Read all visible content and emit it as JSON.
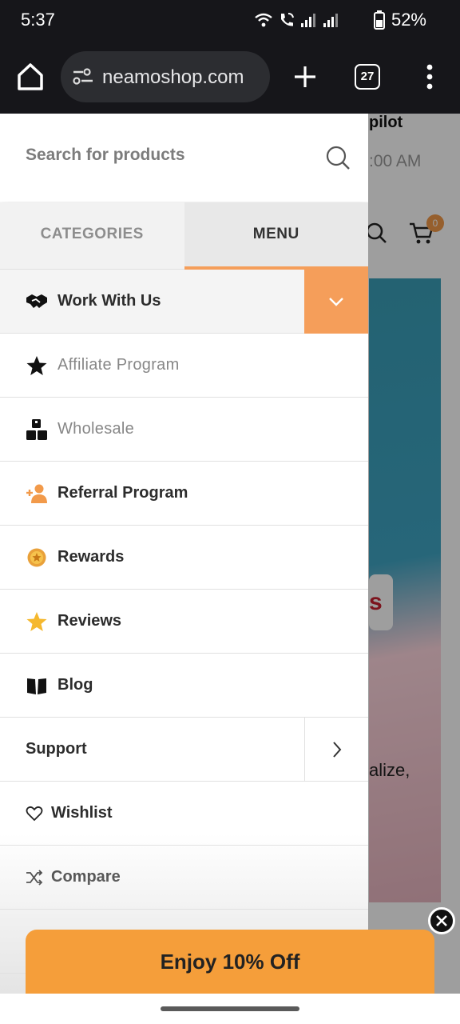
{
  "status_bar": {
    "time": "5:37",
    "battery_percent": "52%",
    "icons": [
      "wifi-icon",
      "wifi-call-icon",
      "signal-icon",
      "signal-icon",
      "battery-icon"
    ]
  },
  "browser": {
    "url": "neamoshop.com",
    "tab_count": "27",
    "icons": [
      "home-icon",
      "site-settings-icon",
      "plus-icon",
      "tabs-icon",
      "more-vert-icon"
    ]
  },
  "background_page": {
    "trustpilot_fragment": "pilot",
    "hours_fragment": ":00 AM",
    "cart_count": "0",
    "badge_fragment": "s",
    "text_fragment": "alize,"
  },
  "drawer": {
    "search": {
      "placeholder": "Search for products"
    },
    "tabs": [
      {
        "label": "CATEGORIES",
        "active": false
      },
      {
        "label": "MENU",
        "active": true
      }
    ],
    "menu_items": [
      {
        "label": "Work With Us",
        "icon": "handshake-icon",
        "expanded": true
      },
      {
        "label": "Affiliate Program",
        "icon": "star-icon"
      },
      {
        "label": "Wholesale",
        "icon": "boxes-icon"
      },
      {
        "label": "Referral Program",
        "icon": "add-user-icon"
      },
      {
        "label": "Rewards",
        "icon": "coin-icon"
      },
      {
        "label": "Reviews",
        "icon": "star-icon"
      },
      {
        "label": "Blog",
        "icon": "book-icon"
      },
      {
        "label": "Support",
        "icon": "",
        "has_submenu": true
      },
      {
        "label": "Wishlist",
        "icon": "heart-icon"
      },
      {
        "label": "Compare",
        "icon": "shuffle-icon"
      }
    ]
  },
  "promo": {
    "label": "Enjoy 10% Off"
  },
  "colors": {
    "accent": "#f59e5a",
    "promo": "#f59e3a",
    "toolbar": "#16161a"
  }
}
